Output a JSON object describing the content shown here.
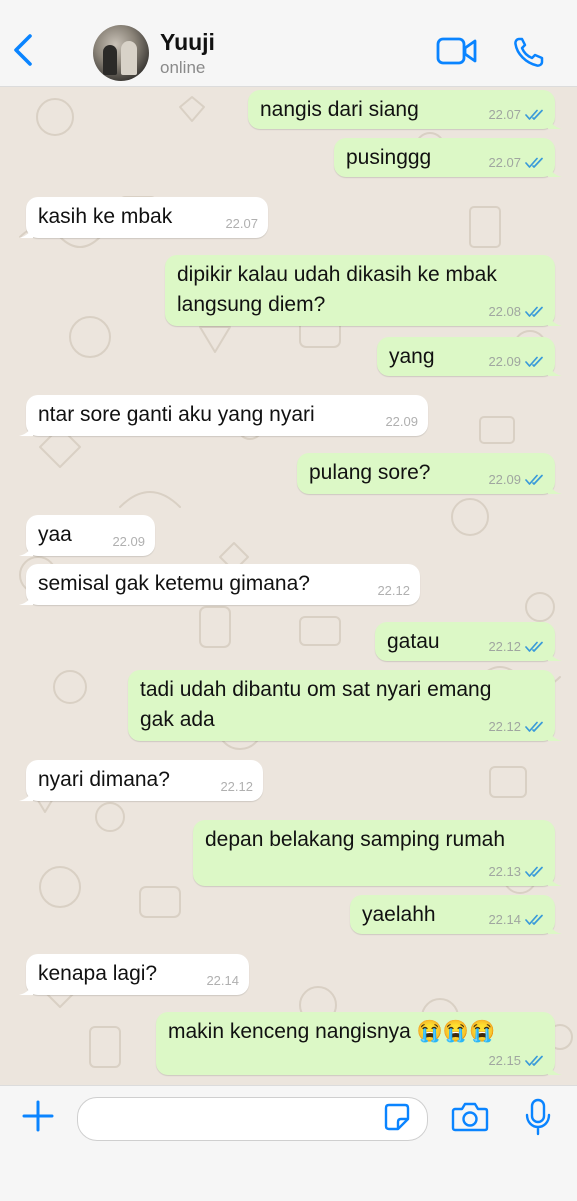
{
  "header": {
    "contact_name": "Yuuji",
    "contact_status": "online",
    "icons": [
      "chevron-left-icon",
      "video-call-icon",
      "phone-icon"
    ]
  },
  "accent_color": "#0a84ff",
  "messages": [
    {
      "dir": "out",
      "text": "nangis dari siang",
      "time": "22.07",
      "read": true
    },
    {
      "dir": "out",
      "text": "pusinggg",
      "time": "22.07",
      "read": true
    },
    {
      "dir": "in",
      "text": "kasih ke mbak",
      "time": "22.07"
    },
    {
      "dir": "out",
      "text": "dipikir kalau udah dikasih ke mbak langsung diem?",
      "lines": [
        "dipikir kalau udah dikasih ke mbak",
        "langsung diem?"
      ],
      "time": "22.08",
      "read": true
    },
    {
      "dir": "out",
      "text": "yang",
      "time": "22.09",
      "read": true
    },
    {
      "dir": "in",
      "text": "ntar sore ganti aku yang nyari",
      "time": "22.09"
    },
    {
      "dir": "out",
      "text": "pulang sore?",
      "time": "22.09",
      "read": true
    },
    {
      "dir": "in",
      "text": "yaa",
      "time": "22.09"
    },
    {
      "dir": "in",
      "text": "semisal gak ketemu gimana?",
      "time": "22.12"
    },
    {
      "dir": "out",
      "text": "gatau",
      "time": "22.12",
      "read": true
    },
    {
      "dir": "out",
      "text": "tadi udah dibantu om sat nyari emang gak ada",
      "lines": [
        "tadi udah dibantu om sat nyari emang",
        "gak ada"
      ],
      "time": "22.12",
      "read": true
    },
    {
      "dir": "in",
      "text": "nyari dimana?",
      "time": "22.12"
    },
    {
      "dir": "out",
      "text": "depan belakang samping rumah",
      "time": "22.13",
      "read": true
    },
    {
      "dir": "out",
      "text": "yaelahh",
      "time": "22.14",
      "read": true
    },
    {
      "dir": "in",
      "text": "kenapa lagi?",
      "time": "22.14"
    },
    {
      "dir": "out",
      "text": "makin kenceng nangisnya 😭😭😭",
      "time": "22.15",
      "read": true
    }
  ],
  "composer": {
    "input_value": "",
    "icons": [
      "plus-icon",
      "sticker-icon",
      "camera-icon",
      "microphone-icon"
    ]
  }
}
